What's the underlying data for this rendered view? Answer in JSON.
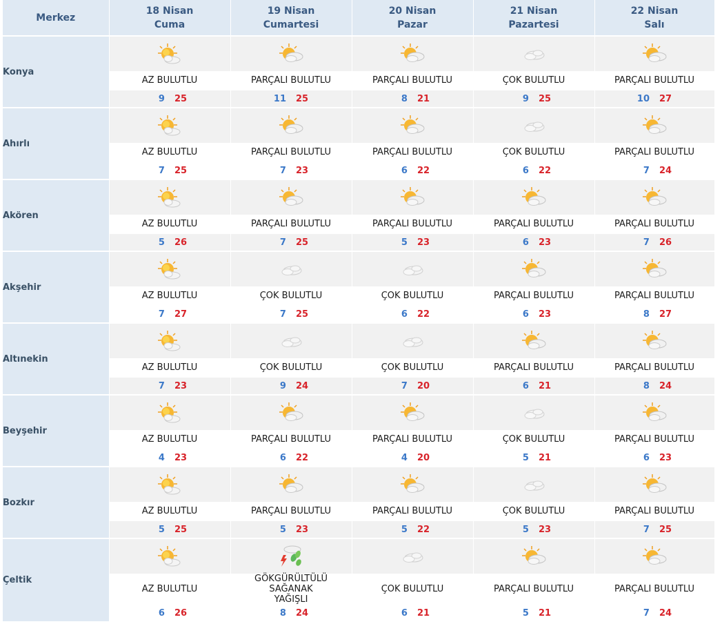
{
  "header": {
    "merkez_label": "Merkez",
    "days": [
      {
        "date": "18 Nisan",
        "day": "Cuma"
      },
      {
        "date": "19 Nisan",
        "day": "Cumartesi"
      },
      {
        "date": "20 Nisan",
        "day": "Pazar"
      },
      {
        "date": "21 Nisan",
        "day": "Pazartesi"
      },
      {
        "date": "22 Nisan",
        "day": "Salı"
      }
    ]
  },
  "colors": {
    "header_bg": "#dfe9f3",
    "header_text": "#3a5a82",
    "min_temp": "#3b78c8",
    "max_temp": "#d8232a",
    "row_shade": "#f1f1f1"
  },
  "rows": [
    {
      "city": "Konya",
      "days": [
        {
          "icon": "sun-cloud-icon",
          "desc": "AZ BULUTLU",
          "min": "9",
          "max": "25"
        },
        {
          "icon": "partly-cloudy-icon",
          "desc": "PARÇALI BULUTLU",
          "min": "11",
          "max": "25"
        },
        {
          "icon": "partly-cloudy-icon",
          "desc": "PARÇALI BULUTLU",
          "min": "8",
          "max": "21"
        },
        {
          "icon": "cloudy-icon",
          "desc": "ÇOK BULUTLU",
          "min": "9",
          "max": "25"
        },
        {
          "icon": "partly-cloudy-icon",
          "desc": "PARÇALI BULUTLU",
          "min": "10",
          "max": "27"
        }
      ]
    },
    {
      "city": "Ahırlı",
      "days": [
        {
          "icon": "sun-cloud-icon",
          "desc": "AZ BULUTLU",
          "min": "7",
          "max": "25"
        },
        {
          "icon": "partly-cloudy-icon",
          "desc": "PARÇALI BULUTLU",
          "min": "7",
          "max": "23"
        },
        {
          "icon": "partly-cloudy-icon",
          "desc": "PARÇALI BULUTLU",
          "min": "6",
          "max": "22"
        },
        {
          "icon": "cloudy-icon",
          "desc": "ÇOK BULUTLU",
          "min": "6",
          "max": "22"
        },
        {
          "icon": "partly-cloudy-icon",
          "desc": "PARÇALI BULUTLU",
          "min": "7",
          "max": "24"
        }
      ]
    },
    {
      "city": "Akören",
      "days": [
        {
          "icon": "sun-cloud-icon",
          "desc": "AZ BULUTLU",
          "min": "5",
          "max": "26"
        },
        {
          "icon": "partly-cloudy-icon",
          "desc": "PARÇALI BULUTLU",
          "min": "7",
          "max": "25"
        },
        {
          "icon": "partly-cloudy-icon",
          "desc": "PARÇALI BULUTLU",
          "min": "5",
          "max": "23"
        },
        {
          "icon": "partly-cloudy-icon",
          "desc": "PARÇALI BULUTLU",
          "min": "6",
          "max": "23"
        },
        {
          "icon": "partly-cloudy-icon",
          "desc": "PARÇALI BULUTLU",
          "min": "7",
          "max": "26"
        }
      ]
    },
    {
      "city": "Akşehir",
      "days": [
        {
          "icon": "sun-cloud-icon",
          "desc": "AZ BULUTLU",
          "min": "7",
          "max": "27"
        },
        {
          "icon": "cloudy-icon",
          "desc": "ÇOK BULUTLU",
          "min": "7",
          "max": "25"
        },
        {
          "icon": "cloudy-icon",
          "desc": "ÇOK BULUTLU",
          "min": "6",
          "max": "22"
        },
        {
          "icon": "partly-cloudy-icon",
          "desc": "PARÇALI BULUTLU",
          "min": "6",
          "max": "23"
        },
        {
          "icon": "partly-cloudy-icon",
          "desc": "PARÇALI BULUTLU",
          "min": "8",
          "max": "27"
        }
      ]
    },
    {
      "city": "Altınekin",
      "days": [
        {
          "icon": "sun-cloud-icon",
          "desc": "AZ BULUTLU",
          "min": "7",
          "max": "23"
        },
        {
          "icon": "cloudy-icon",
          "desc": "ÇOK BULUTLU",
          "min": "9",
          "max": "24"
        },
        {
          "icon": "cloudy-icon",
          "desc": "ÇOK BULUTLU",
          "min": "7",
          "max": "20"
        },
        {
          "icon": "partly-cloudy-icon",
          "desc": "PARÇALI BULUTLU",
          "min": "6",
          "max": "21"
        },
        {
          "icon": "partly-cloudy-icon",
          "desc": "PARÇALI BULUTLU",
          "min": "8",
          "max": "24"
        }
      ]
    },
    {
      "city": "Beyşehir",
      "days": [
        {
          "icon": "sun-cloud-icon",
          "desc": "AZ BULUTLU",
          "min": "4",
          "max": "23"
        },
        {
          "icon": "partly-cloudy-icon",
          "desc": "PARÇALI BULUTLU",
          "min": "6",
          "max": "22"
        },
        {
          "icon": "partly-cloudy-icon",
          "desc": "PARÇALI BULUTLU",
          "min": "4",
          "max": "20"
        },
        {
          "icon": "cloudy-icon",
          "desc": "ÇOK BULUTLU",
          "min": "5",
          "max": "21"
        },
        {
          "icon": "partly-cloudy-icon",
          "desc": "PARÇALI BULUTLU",
          "min": "6",
          "max": "23"
        }
      ]
    },
    {
      "city": "Bozkır",
      "days": [
        {
          "icon": "sun-cloud-icon",
          "desc": "AZ BULUTLU",
          "min": "5",
          "max": "25"
        },
        {
          "icon": "partly-cloudy-icon",
          "desc": "PARÇALI BULUTLU",
          "min": "5",
          "max": "23"
        },
        {
          "icon": "partly-cloudy-icon",
          "desc": "PARÇALI BULUTLU",
          "min": "5",
          "max": "22"
        },
        {
          "icon": "cloudy-icon",
          "desc": "ÇOK BULUTLU",
          "min": "5",
          "max": "23"
        },
        {
          "icon": "partly-cloudy-icon",
          "desc": "PARÇALI BULUTLU",
          "min": "7",
          "max": "25"
        }
      ]
    },
    {
      "city": "Çeltik",
      "days": [
        {
          "icon": "sun-cloud-icon",
          "desc": "AZ BULUTLU",
          "min": "6",
          "max": "26"
        },
        {
          "icon": "thunderstorm-icon",
          "desc": "GÖKGÜRÜLTÜLÜ SAĞANAK YAĞIŞLI",
          "min": "8",
          "max": "24"
        },
        {
          "icon": "cloudy-icon",
          "desc": "ÇOK BULUTLU",
          "min": "6",
          "max": "21"
        },
        {
          "icon": "partly-cloudy-icon",
          "desc": "PARÇALI BULUTLU",
          "min": "5",
          "max": "21"
        },
        {
          "icon": "partly-cloudy-icon",
          "desc": "PARÇALI BULUTLU",
          "min": "7",
          "max": "24"
        }
      ]
    }
  ]
}
